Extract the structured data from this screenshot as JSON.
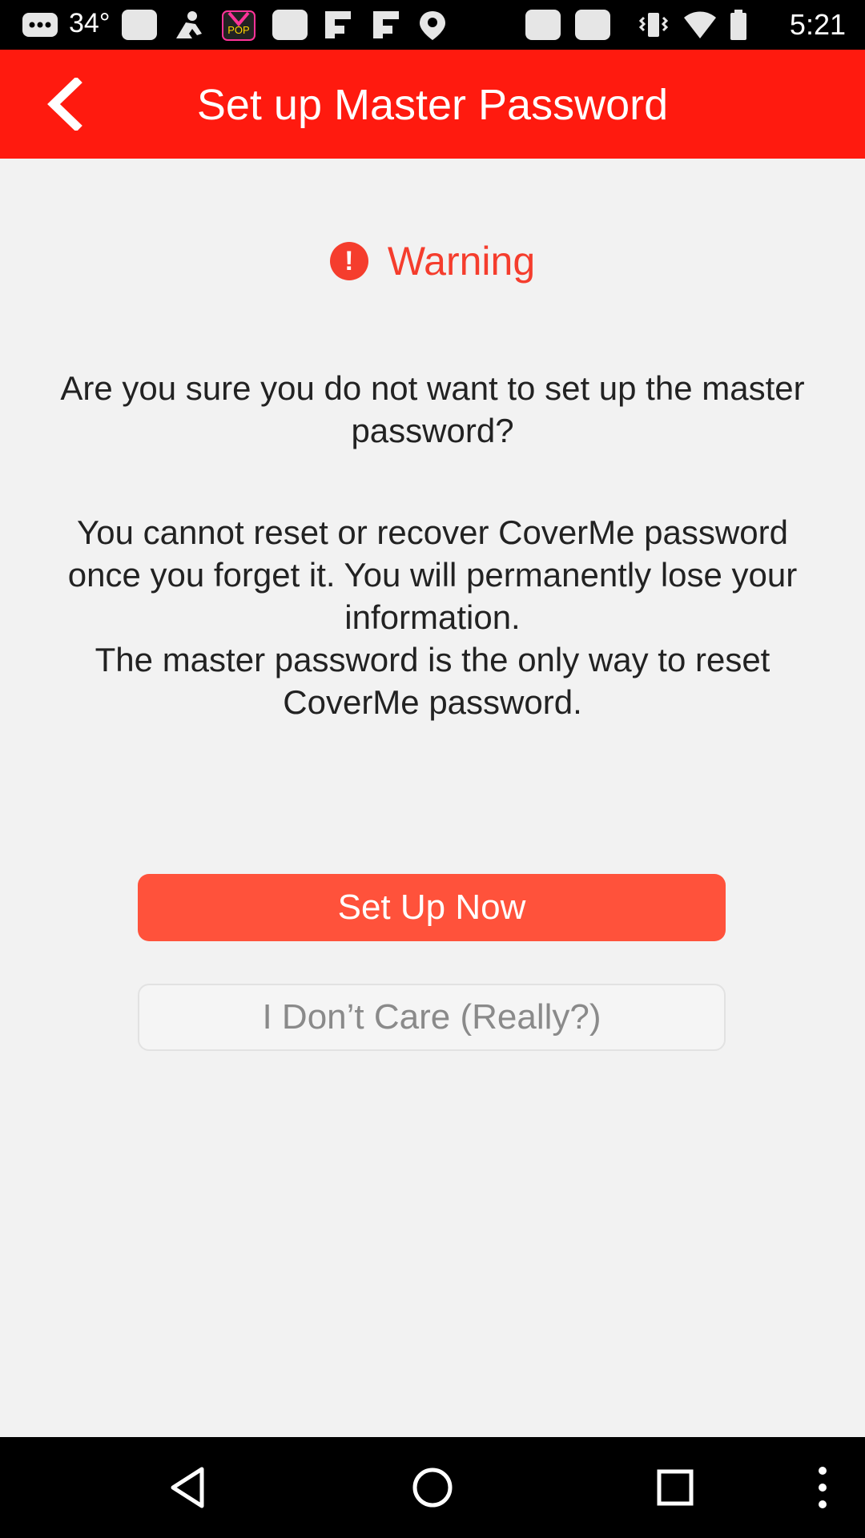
{
  "status_bar": {
    "temperature": "34°",
    "time": "5:21",
    "icons": [
      "messages-icon",
      "notification-icon",
      "person-icon",
      "pop-app-icon",
      "notification-icon",
      "flipboard-icon",
      "flipboard-icon",
      "location-icon",
      "notification-icon",
      "notification-icon"
    ]
  },
  "app_bar": {
    "title": "Set up Master Password",
    "back_icon": "chevron-left-icon",
    "background_color": "#ff1a0f"
  },
  "warning": {
    "icon": "exclamation-icon",
    "label": "Warning",
    "color": "#f53d2d"
  },
  "messages": {
    "question": "Are you sure you do not want to set up the master\npassword?",
    "info": "You cannot reset or recover CoverMe password\nonce you forget it. You will permanently lose your\ninformation.\nThe master password is the only way to reset\nCoverMe password."
  },
  "buttons": {
    "setup_now": "Set Up Now",
    "dont_care": "I Don’t Care (Really?)",
    "primary_color": "#ff523b"
  },
  "nav_bar": {
    "icons": [
      "back-triangle-icon",
      "home-circle-icon",
      "recents-square-icon",
      "overflow-menu-icon"
    ]
  }
}
